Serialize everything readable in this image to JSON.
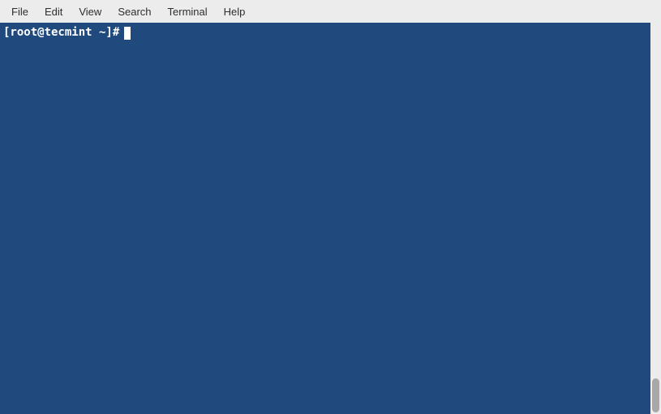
{
  "menubar": {
    "items": [
      {
        "label": "File"
      },
      {
        "label": "Edit"
      },
      {
        "label": "View"
      },
      {
        "label": "Search"
      },
      {
        "label": "Terminal"
      },
      {
        "label": "Help"
      }
    ]
  },
  "terminal": {
    "prompt": "[root@tecmint ~]#",
    "background_color": "#204a7e",
    "text_color": "#ffffff"
  }
}
